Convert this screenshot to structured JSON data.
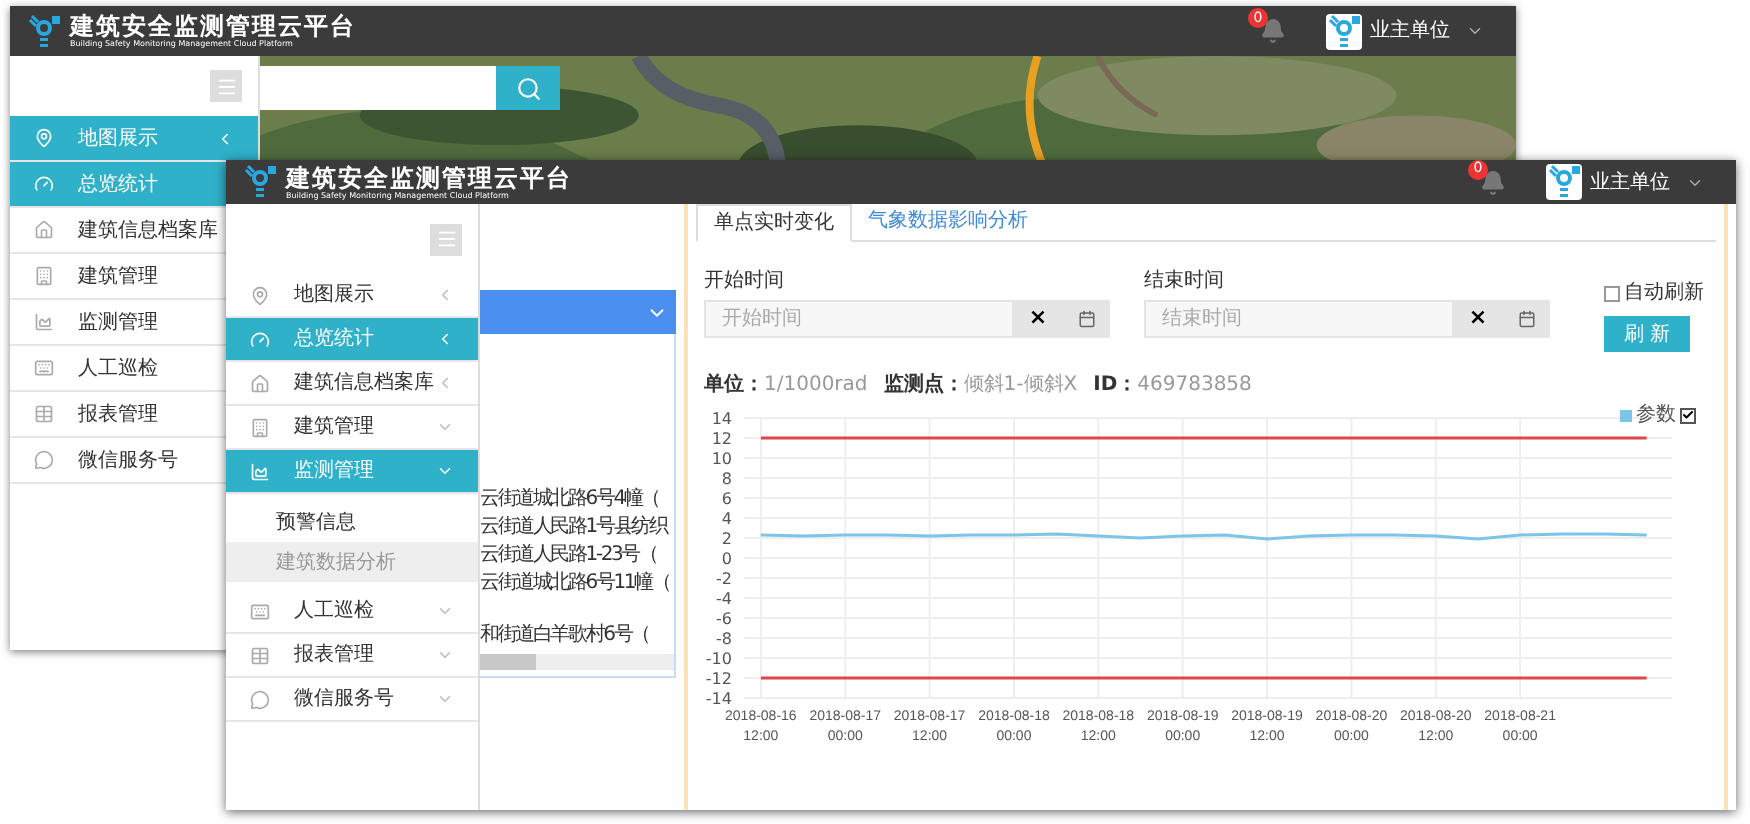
{
  "back_window": {
    "header": {
      "title": "建筑安全监测管理云平台",
      "subtitle": "Building Safety Monitoring Management Cloud Platform",
      "notification_count": "0",
      "user": "业主单位"
    },
    "sidebar": {
      "items": [
        {
          "label": "地图展示",
          "selected": true,
          "caret_down": false
        },
        {
          "label": "总览统计",
          "selected": true
        },
        {
          "label": "建筑信息档案库",
          "selected": false
        },
        {
          "label": "建筑管理",
          "selected": false
        },
        {
          "label": "监测管理",
          "selected": false
        },
        {
          "label": "人工巡检",
          "selected": false
        },
        {
          "label": "报表管理",
          "selected": false
        },
        {
          "label": "微信服务号",
          "selected": false
        }
      ]
    }
  },
  "front_window": {
    "header": {
      "title": "建筑安全监测管理云平台",
      "subtitle": "Building Safety Monitoring Management Cloud Platform",
      "notification_count": "0",
      "user": "业主单位"
    },
    "sidebar": {
      "items": [
        {
          "label": "地图展示",
          "selected": false,
          "caret_down": false
        },
        {
          "label": "总览统计",
          "selected": true,
          "caret_down": false
        },
        {
          "label": "建筑信息档案库",
          "selected": false,
          "caret_down": false
        },
        {
          "label": "建筑管理",
          "selected": false,
          "caret_down": true
        },
        {
          "label": "监测管理",
          "selected": true,
          "caret_down": true,
          "expanded": true,
          "children": [
            {
              "label": "预警信息",
              "selected": false
            },
            {
              "label": "建筑数据分析",
              "selected": true
            }
          ]
        },
        {
          "label": "人工巡检",
          "selected": false,
          "caret_down": true
        },
        {
          "label": "报表管理",
          "selected": false,
          "caret_down": true
        },
        {
          "label": "微信服务号",
          "selected": false,
          "caret_down": true
        }
      ]
    },
    "building_list": {
      "rows": [
        "云街道城北路6号4幢（",
        "云街道人民路1号县纺织",
        "云街道人民路1-23号（",
        "云街道城北路6号11幢（",
        "和街道白羊歌村6号（"
      ]
    },
    "tabs": [
      {
        "label": "单点实时变化",
        "selected": true
      },
      {
        "label": "气象数据影响分析",
        "selected": false
      }
    ],
    "form": {
      "start": {
        "label": "开始时间",
        "placeholder": "开始时间",
        "clear": "×"
      },
      "end": {
        "label": "结束时间",
        "placeholder": "结束时间",
        "clear": "×"
      },
      "auto_refresh": {
        "label": "自动刷新",
        "checked": false
      },
      "refresh_button": "刷 新"
    },
    "legend_checkbox": {
      "checked": true
    },
    "chart_info": [
      {
        "label": "单位：",
        "value": "1/1000rad"
      },
      {
        "label": "监测点：",
        "value": "倾斜1-倾斜X"
      },
      {
        "label": "ID：",
        "value": "469783858"
      }
    ],
    "chart_data": {
      "type": "line",
      "grid": true,
      "ylim": [
        -14,
        14
      ],
      "yticks": [
        -14,
        -12,
        -10,
        -8,
        -6,
        -4,
        -2,
        0,
        2,
        4,
        6,
        8,
        10,
        12,
        14
      ],
      "categories": [
        "2018-08-16 12:00",
        null,
        "2018-08-17 00:00",
        null,
        "2018-08-17 12:00",
        null,
        "2018-08-18 00:00",
        null,
        "2018-08-18 12:00",
        null,
        "2018-08-19 00:00",
        null,
        "2018-08-19 12:00",
        null,
        "2018-08-20 00:00",
        null,
        "2018-08-20 12:00",
        null,
        "2018-08-21 00:00",
        null,
        null,
        null
      ],
      "series": [
        {
          "name": "参数",
          "color": "#7cc4e8",
          "values": [
            2.3,
            2.2,
            2.3,
            2.3,
            2.2,
            2.3,
            2.3,
            2.4,
            2.2,
            2.0,
            2.2,
            2.3,
            1.9,
            2.2,
            2.3,
            2.3,
            2.2,
            1.9,
            2.3,
            2.4,
            2.4,
            2.3
          ]
        },
        {
          "color": "#e0474c",
          "values": [
            12,
            12,
            12,
            12,
            12,
            12,
            12,
            12,
            12,
            12,
            12,
            12,
            12,
            12,
            12,
            12,
            12,
            12,
            12,
            12,
            12,
            12
          ]
        },
        {
          "color": "#e0474c",
          "values": [
            -12,
            -12,
            -12,
            -12,
            -12,
            -12,
            -12,
            -12,
            -12,
            -12,
            -12,
            -12,
            -12,
            -12,
            -12,
            -12,
            -12,
            -12,
            -12,
            -12,
            -12,
            -12
          ]
        }
      ]
    }
  }
}
